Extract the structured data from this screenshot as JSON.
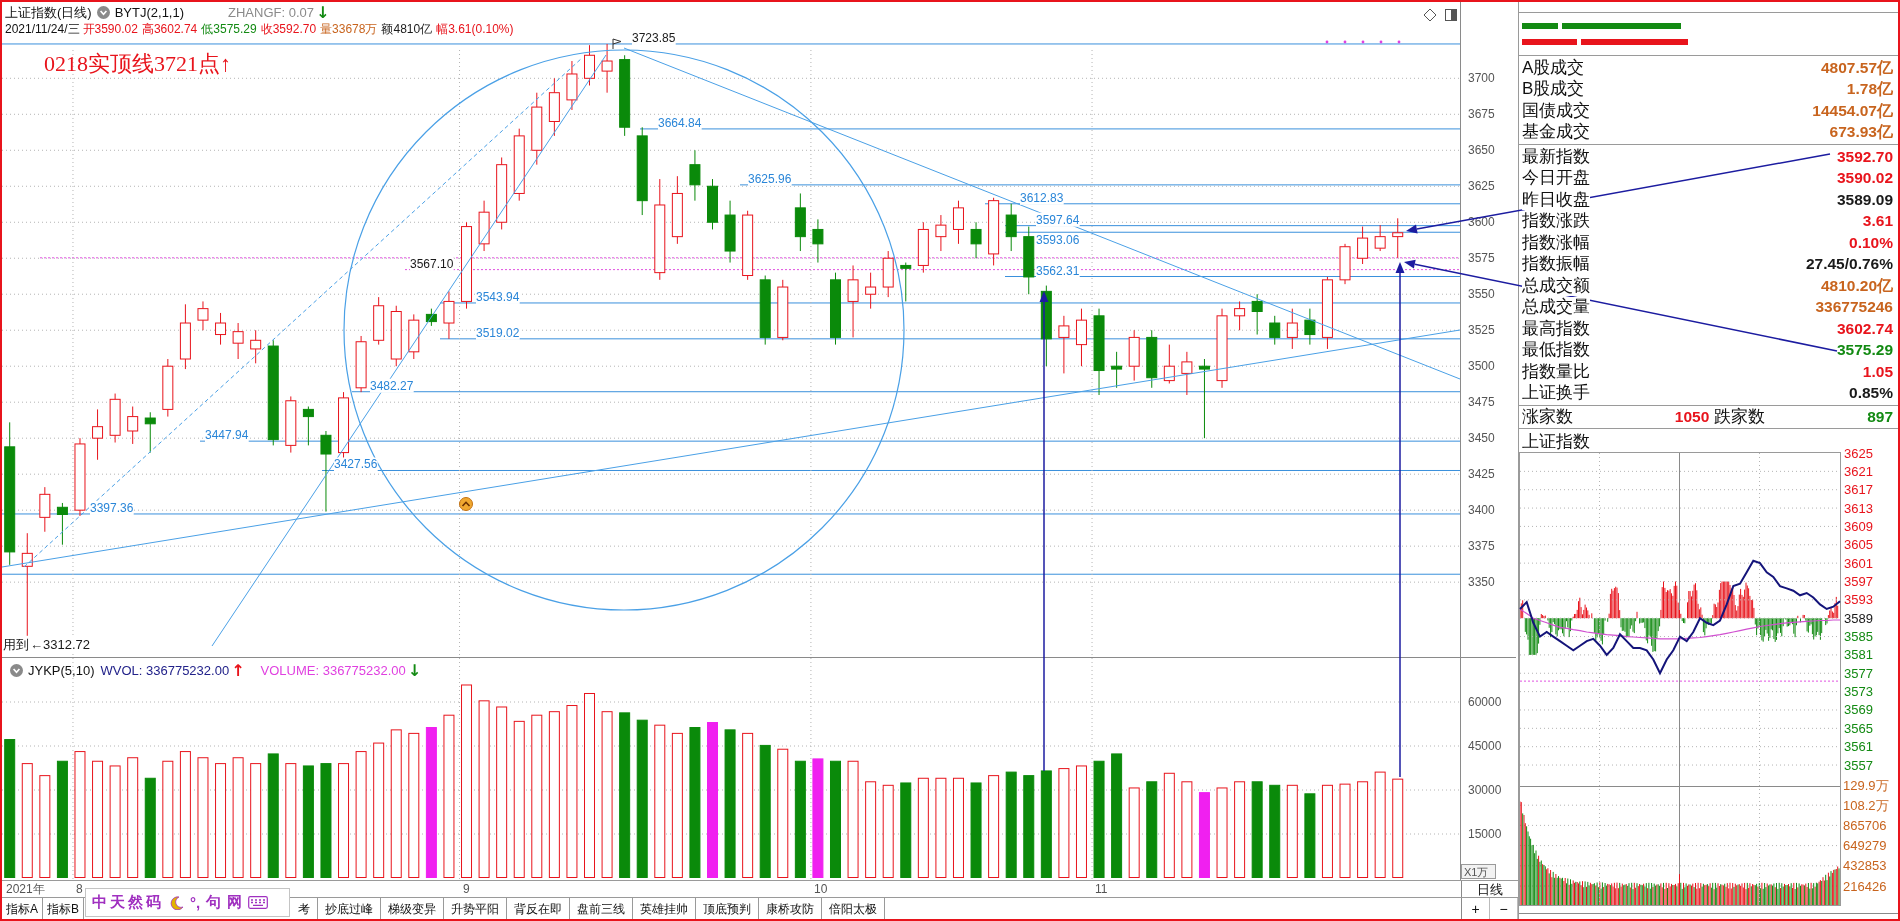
{
  "header": {
    "title": "上证指数(日线)",
    "indicator": "BYTJ(2,1,1)",
    "zhangf": {
      "text": "ZHANGF: 0.07",
      "arrow": {
        "text": "↓",
        "color": "#138a13"
      }
    },
    "date": "2021/11/24/三",
    "quotes": [
      {
        "text": "开3590.02",
        "color": "#e8141c"
      },
      {
        "text": "高3602.74",
        "color": "#e8141c"
      },
      {
        "text": "低3575.29",
        "color": "#138a13"
      },
      {
        "text": "收3592.70",
        "color": "#e8141c"
      },
      {
        "text": "量33678万",
        "color": "#c8641e"
      },
      {
        "text": "额4810亿",
        "color": "#1a1a1a"
      },
      {
        "text": "幅3.61(0.10%)",
        "color": "#e8141c"
      }
    ]
  },
  "price_chart": {
    "annotation": "0218实顶线3721点↑",
    "level_labels": [
      {
        "text": "3723.85",
        "color": "#1a1a1a"
      },
      {
        "text": "3664.84",
        "color": "#2a86d8"
      },
      {
        "text": "3625.96",
        "color": "#2a86d8"
      },
      {
        "text": "3612.83",
        "color": "#2a86d8"
      },
      {
        "text": "3597.64",
        "color": "#2a86d8"
      },
      {
        "text": "3593.06",
        "color": "#2a86d8"
      },
      {
        "text": "3567.10",
        "color": "#1a1a1a"
      },
      {
        "text": "3562.31",
        "color": "#2a86d8"
      },
      {
        "text": "3543.94",
        "color": "#2a86d8"
      },
      {
        "text": "3519.02",
        "color": "#2a86d8"
      },
      {
        "text": "3482.27",
        "color": "#2a86d8"
      },
      {
        "text": "3447.94",
        "color": "#2a86d8"
      },
      {
        "text": "3427.56",
        "color": "#2a86d8"
      },
      {
        "text": "3397.36",
        "color": "#2a86d8"
      }
    ],
    "low_note": "用到",
    "low_label": "←3312.72",
    "chart_data": {
      "type": "candlestick",
      "ylim": [
        3298,
        3753
      ],
      "yticks": [
        3700,
        3675,
        3650,
        3625,
        3600,
        3575,
        3550,
        3525,
        3500,
        3475,
        3450,
        3425,
        3400,
        3375,
        3350
      ],
      "grid": true,
      "ohlc": [
        [
          3444,
          3461,
          3362,
          3371
        ],
        [
          3361,
          3384,
          3312.72,
          3370
        ],
        [
          3395,
          3416,
          3385,
          3411
        ],
        [
          3402,
          3405,
          3376,
          3397
        ],
        [
          3400,
          3450,
          3396,
          3446
        ],
        [
          3450,
          3470,
          3435,
          3458
        ],
        [
          3452,
          3481,
          3447,
          3477
        ],
        [
          3455,
          3472,
          3446,
          3465
        ],
        [
          3464,
          3468,
          3440,
          3460
        ],
        [
          3470,
          3505,
          3465,
          3500
        ],
        [
          3505,
          3543,
          3498,
          3530
        ],
        [
          3532,
          3545,
          3525,
          3540
        ],
        [
          3522,
          3537,
          3515,
          3530
        ],
        [
          3516,
          3530,
          3505,
          3524
        ],
        [
          3512,
          3525,
          3502,
          3518
        ],
        [
          3514,
          3518,
          3445,
          3449
        ],
        [
          3445,
          3479,
          3440,
          3476
        ],
        [
          3470,
          3472,
          3445,
          3465
        ],
        [
          3452,
          3455,
          3399,
          3439
        ],
        [
          3440,
          3482,
          3436,
          3478
        ],
        [
          3485,
          3521,
          3482,
          3517
        ],
        [
          3518,
          3548,
          3515,
          3542
        ],
        [
          3505,
          3542,
          3500,
          3538
        ],
        [
          3510,
          3536,
          3505,
          3532
        ],
        [
          3536,
          3540,
          3528,
          3531
        ],
        [
          3530,
          3552,
          3519,
          3545
        ],
        [
          3545,
          3600,
          3540,
          3597
        ],
        [
          3585,
          3615,
          3580,
          3607
        ],
        [
          3600,
          3645,
          3595,
          3640
        ],
        [
          3620,
          3665,
          3615,
          3660
        ],
        [
          3650,
          3690,
          3640,
          3680
        ],
        [
          3670,
          3700,
          3660,
          3690
        ],
        [
          3685,
          3712,
          3678,
          3703
        ],
        [
          3700,
          3723,
          3695,
          3716
        ],
        [
          3705,
          3723.85,
          3690,
          3712
        ],
        [
          3713,
          3716,
          3660,
          3666
        ],
        [
          3660,
          3666,
          3605,
          3615
        ],
        [
          3565,
          3630,
          3560,
          3612
        ],
        [
          3590,
          3632,
          3585,
          3620
        ],
        [
          3640,
          3650,
          3615,
          3626
        ],
        [
          3625,
          3630,
          3595,
          3600
        ],
        [
          3605,
          3615,
          3572,
          3580
        ],
        [
          3563,
          3608,
          3560,
          3605
        ],
        [
          3560,
          3563,
          3515,
          3520
        ],
        [
          3520,
          3560,
          3518,
          3555
        ],
        [
          3610,
          3620,
          3580,
          3590
        ],
        [
          3595,
          3602,
          3572,
          3585
        ],
        [
          3560,
          3565,
          3515,
          3520
        ],
        [
          3545,
          3570,
          3520,
          3560
        ],
        [
          3550,
          3565,
          3540,
          3555
        ],
        [
          3555,
          3580,
          3548,
          3575
        ],
        [
          3570,
          3572,
          3545,
          3568
        ],
        [
          3570,
          3600,
          3565,
          3595
        ],
        [
          3590,
          3605,
          3580,
          3598
        ],
        [
          3595,
          3615,
          3585,
          3610
        ],
        [
          3595,
          3600,
          3575,
          3585
        ],
        [
          3578,
          3617,
          3570,
          3615
        ],
        [
          3605,
          3612.83,
          3580,
          3590
        ],
        [
          3590,
          3597,
          3550,
          3562
        ],
        [
          3552,
          3556,
          3500,
          3519
        ],
        [
          3520,
          3535,
          3495,
          3528
        ],
        [
          3515,
          3540,
          3500,
          3532
        ],
        [
          3535,
          3540,
          3480,
          3497
        ],
        [
          3500,
          3510,
          3485,
          3498
        ],
        [
          3500,
          3525,
          3490,
          3520
        ],
        [
          3520,
          3525,
          3485,
          3492
        ],
        [
          3490,
          3515,
          3488,
          3500
        ],
        [
          3495,
          3510,
          3480,
          3503
        ],
        [
          3500,
          3505,
          3450,
          3498
        ],
        [
          3490,
          3540,
          3485,
          3535
        ],
        [
          3535,
          3545,
          3525,
          3540
        ],
        [
          3545,
          3550,
          3522,
          3538
        ],
        [
          3530,
          3535,
          3515,
          3520
        ],
        [
          3520,
          3540,
          3512,
          3530
        ],
        [
          3532,
          3540,
          3515,
          3522
        ],
        [
          3520,
          3562,
          3512,
          3560
        ],
        [
          3560,
          3585,
          3557,
          3583
        ],
        [
          3575,
          3597,
          3571,
          3589
        ],
        [
          3582,
          3598,
          3580,
          3590
        ],
        [
          3590.02,
          3602.74,
          3575.29,
          3592.7
        ]
      ]
    }
  },
  "volume_panel": {
    "indicator": "JYKP(5,10)",
    "lines": [
      {
        "text": "WVOL: 336775232.00",
        "color": "#22228a",
        "arrow": {
          "text": "↑",
          "color": "#e8141c"
        }
      },
      {
        "text": "VOLUME: 336775232.00",
        "color": "#e040e0",
        "arrow": {
          "text": "↓",
          "color": "#138a13"
        }
      }
    ],
    "unit": "X1万",
    "chart_data": {
      "type": "bar",
      "ylim": [
        0,
        75000
      ],
      "yticks": [
        60000,
        45000,
        30000,
        15000
      ],
      "grid": true,
      "categories": [
        null,
        null,
        null,
        null,
        "8",
        null,
        null,
        null,
        null,
        null,
        null,
        null,
        null,
        null,
        null,
        null,
        null,
        null,
        null,
        null,
        null,
        null,
        null,
        null,
        null,
        null,
        "9",
        null,
        null,
        null,
        null,
        null,
        null,
        null,
        null,
        null,
        null,
        null,
        null,
        null,
        null,
        null,
        null,
        null,
        null,
        null,
        "10",
        null,
        null,
        null,
        null,
        null,
        null,
        null,
        null,
        null,
        null,
        null,
        null,
        null,
        null,
        null,
        "11",
        null,
        null,
        null,
        null,
        null,
        null,
        null,
        null,
        null,
        null,
        null,
        null,
        null,
        null,
        null,
        null,
        null
      ],
      "series": [
        {
          "color": "#e8141c",
          "values": [
            null,
            39000,
            34900,
            null,
            43100,
            39800,
            38200,
            41000,
            null,
            39800,
            43100,
            41000,
            39000,
            41000,
            39000,
            null,
            39000,
            null,
            null,
            39000,
            43100,
            46000,
            50500,
            49300,
            null,
            55500,
            65800,
            60400,
            58300,
            53400,
            55500,
            56700,
            58800,
            62900,
            56700,
            null,
            null,
            52100,
            49300,
            null,
            null,
            null,
            49300,
            null,
            43900,
            null,
            null,
            null,
            39800,
            32800,
            31600,
            null,
            34000,
            34000,
            34000,
            null,
            34900,
            null,
            null,
            null,
            37300,
            38200,
            null,
            null,
            30700,
            null,
            35700,
            32800,
            null,
            30700,
            32800,
            null,
            null,
            31600,
            null,
            31600,
            32000,
            32800,
            36100,
            33700
          ]
        },
        {
          "color": "#0a8a0a",
          "values": [
            47200,
            null,
            null,
            39800,
            null,
            null,
            null,
            null,
            34000,
            null,
            null,
            null,
            null,
            null,
            null,
            42300,
            null,
            38200,
            39000,
            null,
            null,
            null,
            null,
            null,
            null,
            null,
            null,
            null,
            null,
            null,
            null,
            null,
            null,
            null,
            null,
            56300,
            53800,
            null,
            null,
            51300,
            null,
            50500,
            null,
            45200,
            null,
            39800,
            null,
            39800,
            null,
            null,
            null,
            32400,
            null,
            null,
            null,
            32400,
            null,
            36100,
            34900,
            36500,
            null,
            null,
            39800,
            42300,
            null,
            32800,
            null,
            null,
            null,
            null,
            null,
            32800,
            31600,
            null,
            28700,
            null,
            null,
            null,
            null,
            null
          ]
        },
        {
          "color": "#f020f0",
          "values": [
            null,
            null,
            null,
            null,
            null,
            null,
            null,
            null,
            null,
            null,
            null,
            null,
            null,
            null,
            null,
            null,
            null,
            null,
            null,
            null,
            null,
            null,
            null,
            null,
            51300,
            null,
            null,
            null,
            null,
            null,
            null,
            null,
            null,
            null,
            null,
            null,
            null,
            null,
            null,
            null,
            53000,
            null,
            null,
            null,
            null,
            null,
            40600,
            null,
            null,
            null,
            null,
            null,
            null,
            null,
            null,
            null,
            null,
            null,
            null,
            null,
            null,
            null,
            null,
            null,
            null,
            null,
            null,
            null,
            29100,
            null,
            null,
            null,
            null,
            null,
            null,
            null,
            null,
            null,
            null,
            null
          ]
        }
      ]
    }
  },
  "date_axis": {
    "year": "2021年"
  },
  "period": {
    "label": "日线",
    "zoom_in": "+",
    "zoom_out": "−"
  },
  "indicator_tabs": [
    {
      "label": "指标A",
      "selected": false
    },
    {
      "label": "指标B",
      "selected": false
    }
  ],
  "template_tabs": [
    {
      "label": "考",
      "selected": false
    },
    {
      "label": "抄底过峰",
      "selected": false
    },
    {
      "label": "梯级变异",
      "selected": false
    },
    {
      "label": "升势平阳",
      "selected": false
    },
    {
      "label": "背反在即",
      "selected": false
    },
    {
      "label": "盘前三线",
      "selected": false
    },
    {
      "label": "英雄挂帅",
      "selected": false
    },
    {
      "label": "顶底预判",
      "selected": false
    },
    {
      "label": "康桥攻防",
      "selected": false
    },
    {
      "label": "倍阳太极",
      "selected": false
    }
  ],
  "ime_toolbar": {
    "name": "中天然码",
    "punctuation": "°,",
    "buttons": [
      "句",
      "网"
    ]
  },
  "right_panel": {
    "market_totals": [
      {
        "label": "A股成交",
        "value": "4807.57亿"
      },
      {
        "label": "B股成交",
        "value": "1.78亿"
      },
      {
        "label": "国债成交",
        "value": "14454.07亿"
      },
      {
        "label": "基金成交",
        "value": "673.93亿"
      }
    ],
    "index_stats": [
      {
        "label": "最新指数",
        "value": "3592.70",
        "color": "#e8141c"
      },
      {
        "label": "今日开盘",
        "value": "3590.02",
        "color": "#e8141c"
      },
      {
        "label": "昨日收盘",
        "value": "3589.09",
        "color": "#1a1a1a"
      },
      {
        "label": "指数涨跌",
        "value": "3.61",
        "color": "#e8141c"
      },
      {
        "label": "指数涨幅",
        "value": "0.10%",
        "color": "#e8141c"
      },
      {
        "label": "指数振幅",
        "value": "27.45/0.76%",
        "color": "#1a1a1a"
      },
      {
        "label": "总成交额",
        "value": "4810.20亿",
        "color": "#c8641e"
      },
      {
        "label": "总成交量",
        "value": "336775246",
        "color": "#c8641e"
      },
      {
        "label": "最高指数",
        "value": "3602.74",
        "color": "#e8141c"
      },
      {
        "label": "最低指数",
        "value": "3575.29",
        "color": "#138a13"
      },
      {
        "label": "指数量比",
        "value": "1.05",
        "color": "#e8141c"
      },
      {
        "label": "上证换手",
        "value": "0.85%",
        "color": "#1a1a1a"
      }
    ],
    "breadth": {
      "rise_label": "涨家数",
      "rise_count": "1050",
      "fall_label": "跌家数",
      "fall_count": "897"
    },
    "intraday": {
      "title": "上证指数",
      "tick_labels": [
        {
          "color": "#e8141c"
        },
        {
          "color": "#e8141c"
        },
        {
          "color": "#e8141c"
        },
        {
          "color": "#e8141c"
        },
        {
          "color": "#e8141c"
        },
        {
          "color": "#e8141c"
        },
        {
          "color": "#e8141c"
        },
        {
          "color": "#e8141c"
        },
        {
          "color": "#e8141c"
        },
        {
          "color": "#1a1a1a"
        },
        {
          "color": "#138a13"
        },
        {
          "color": "#138a13"
        },
        {
          "color": "#138a13"
        },
        {
          "color": "#138a13"
        },
        {
          "color": "#138a13"
        },
        {
          "color": "#138a13"
        },
        {
          "color": "#138a13"
        },
        {
          "color": "#138a13"
        }
      ],
      "chart_data": {
        "type": "line",
        "ylim": [
          3526.5,
          3625
        ],
        "yticks": [
          3625,
          3621,
          3617,
          3613,
          3609,
          3605,
          3601,
          3597,
          3593,
          3589,
          3585,
          3581,
          3577,
          3573,
          3569,
          3565,
          3561,
          3557
        ],
        "grid": true,
        "series": [
          {
            "color": "#14147a",
            "values": [
              3591,
              3592.5,
              3588,
              3585,
              3586,
              3585,
              3584,
              3583,
              3582,
              3583,
              3584,
              3584.5,
              3583,
              3581,
              3582.5,
              3585.5,
              3584,
              3582.5,
              3582.5,
              3582,
              3580,
              3577,
              3580,
              3582,
              3585,
              3584,
              3586,
              3589,
              3588,
              3587.5,
              3588.5,
              3592,
              3596,
              3596.5,
              3599,
              3601.5,
              3601,
              3599,
              3598,
              3596,
              3595.5,
              3595,
              3594,
              3594.5,
              3593.5,
              3592,
              3591,
              3591.5,
              3592.7
            ]
          },
          {
            "color": "#d050d0",
            "values": [
              3591,
              3590,
              3589,
              3588.5,
              3588,
              3587.5,
              3587,
              3586.8,
              3586.5,
              3586.3,
              3586,
              3585.8,
              3585.6,
              3585.4,
              3585.3,
              3585.2,
              3585,
              3584.9,
              3584.8,
              3584.7,
              3584.6,
              3584.5,
              3584.5,
              3584.5,
              3584.5,
              3584.6,
              3584.7,
              3584.8,
              3585,
              3585.2,
              3585.4,
              3585.7,
              3586,
              3586.3,
              3586.6,
              3586.9,
              3587.2,
              3587.4,
              3587.6,
              3587.8,
              3588,
              3588.1,
              3588.2,
              3588.3,
              3588.4,
              3588.5,
              3588.5,
              3588.6,
              3588.6
            ]
          }
        ]
      },
      "volume_axis": [
        "129.9万",
        "108.2万",
        "865706",
        "649279",
        "432853",
        "216426"
      ]
    }
  }
}
